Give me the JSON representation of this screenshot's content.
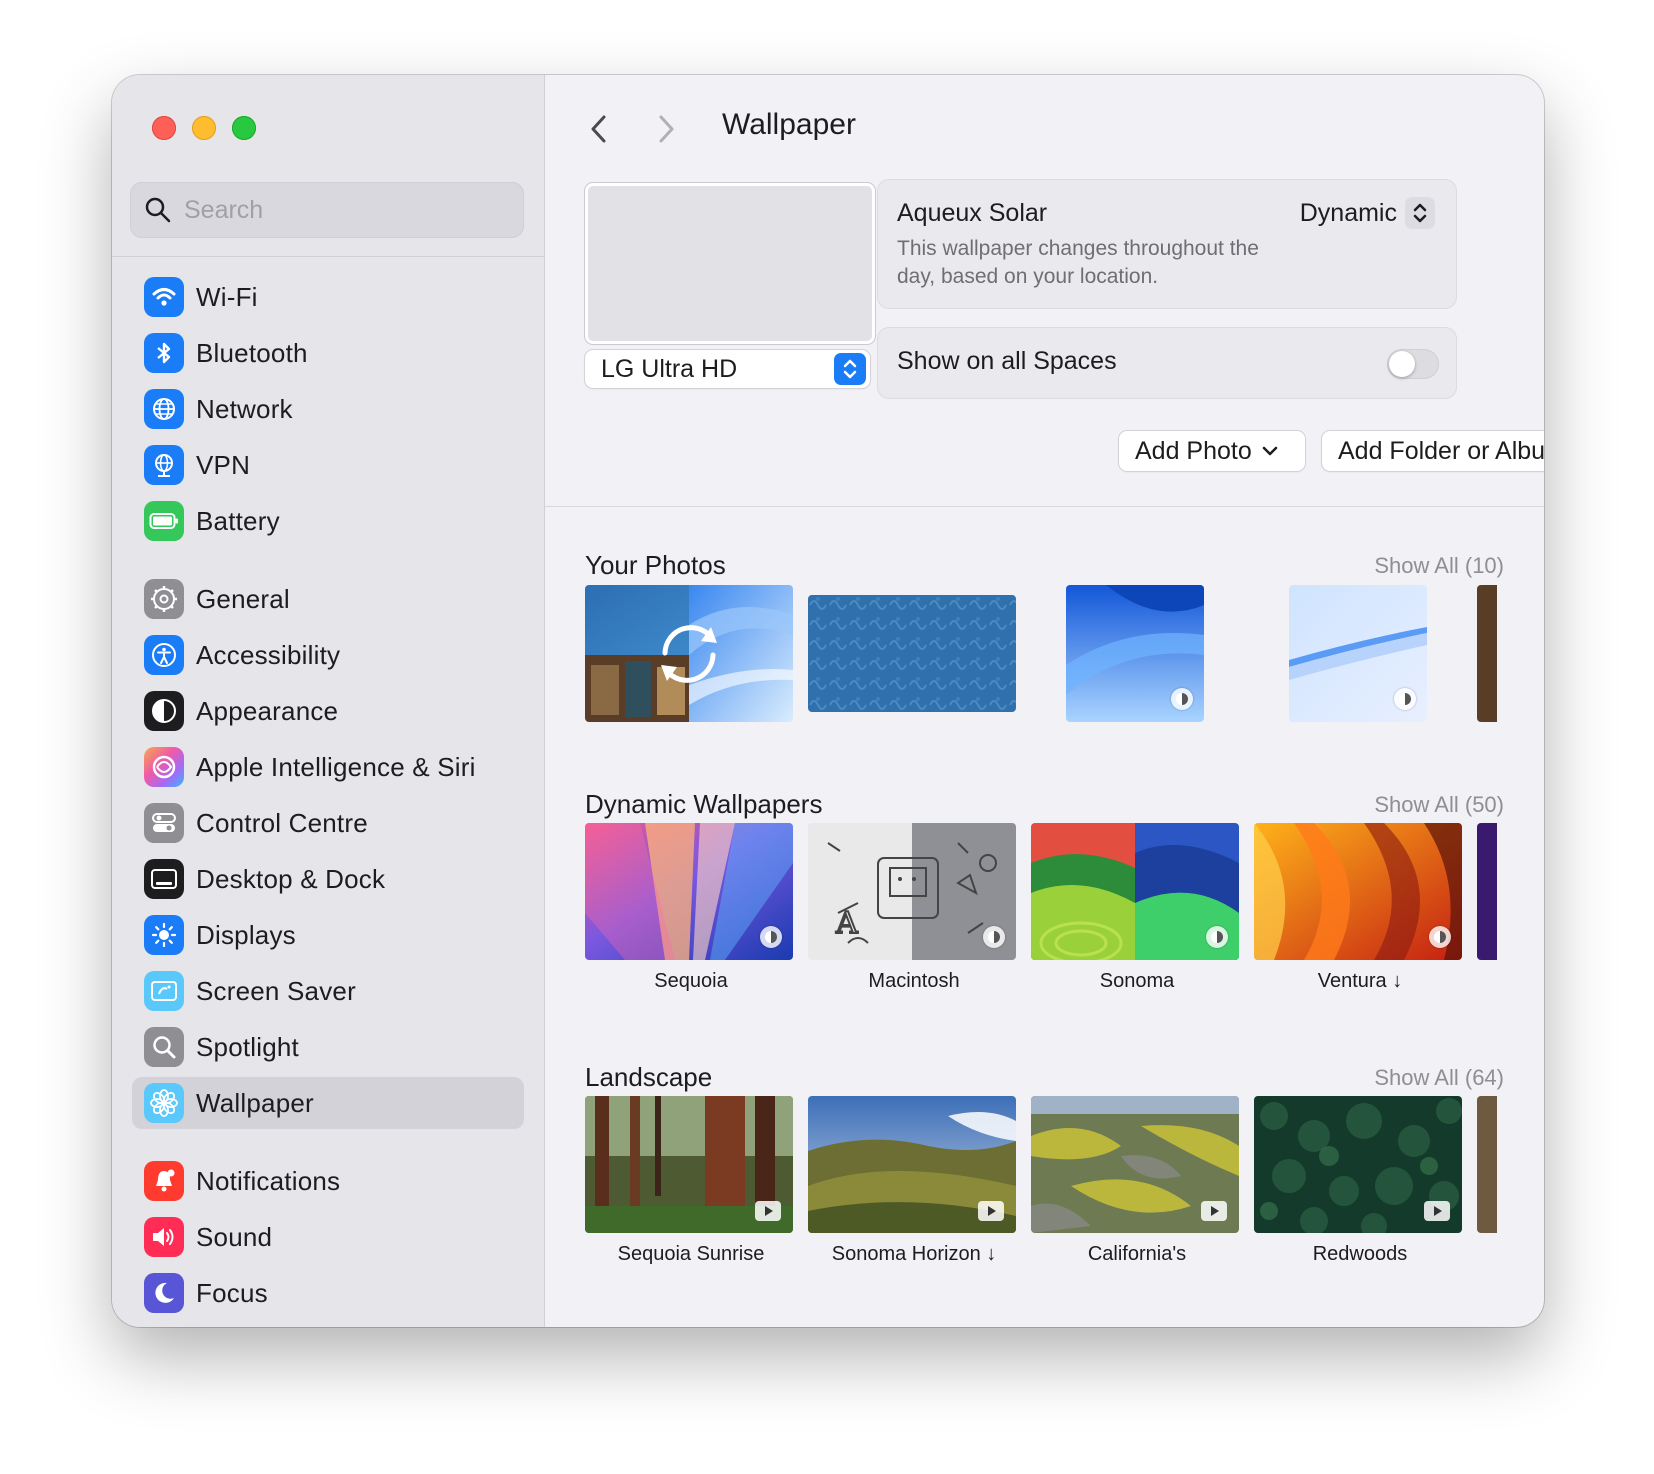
{
  "search": {
    "placeholder": "Search"
  },
  "sidebar": {
    "groups": [
      [
        {
          "label": "Wi-Fi",
          "icon": "wifi-icon",
          "color": "#1a7cf7"
        },
        {
          "label": "Bluetooth",
          "icon": "bluetooth-icon",
          "color": "#1a7cf7"
        },
        {
          "label": "Network",
          "icon": "globe-icon",
          "color": "#1a7cf7"
        },
        {
          "label": "VPN",
          "icon": "vpn-globe-icon",
          "color": "#1a7cf7"
        },
        {
          "label": "Battery",
          "icon": "battery-icon",
          "color": "#34c759"
        }
      ],
      [
        {
          "label": "General",
          "icon": "gear-icon",
          "color": "#8e8e93"
        },
        {
          "label": "Accessibility",
          "icon": "accessibility-icon",
          "color": "#1a7cf7"
        },
        {
          "label": "Appearance",
          "icon": "appearance-icon",
          "color": "#1d1d1f"
        },
        {
          "label": "Apple Intelligence & Siri",
          "icon": "siri-icon",
          "color": "#e85fb0"
        },
        {
          "label": "Control Centre",
          "icon": "control-centre-icon",
          "color": "#8e8e93"
        },
        {
          "label": "Desktop & Dock",
          "icon": "desktop-dock-icon",
          "color": "#1d1d1f"
        },
        {
          "label": "Displays",
          "icon": "sun-icon",
          "color": "#1a7cf7"
        },
        {
          "label": "Screen Saver",
          "icon": "screen-saver-icon",
          "color": "#5ac8fa"
        },
        {
          "label": "Spotlight",
          "icon": "magnifier-icon",
          "color": "#8e8e93"
        },
        {
          "label": "Wallpaper",
          "icon": "flower-icon",
          "color": "#5ac8fa",
          "selected": true
        }
      ],
      [
        {
          "label": "Notifications",
          "icon": "bell-icon",
          "color": "#ff3b30"
        },
        {
          "label": "Sound",
          "icon": "speaker-icon",
          "color": "#ff2d55"
        },
        {
          "label": "Focus",
          "icon": "moon-icon",
          "color": "#5856d6"
        }
      ]
    ]
  },
  "header": {
    "title": "Wallpaper"
  },
  "current": {
    "display": "LG Ultra HD",
    "name": "Aqueux Solar",
    "description": "This wallpaper changes throughout the day, based on your location.",
    "mode": "Dynamic",
    "spaces_label": "Show on all Spaces",
    "spaces_on": false
  },
  "buttons": {
    "add_photo": "Add Photo",
    "add_folder": "Add Folder or Album"
  },
  "sections": [
    {
      "title": "Your Photos",
      "show_all": "Show All (10)",
      "items": [
        {
          "label": "",
          "style": "shuffle"
        },
        {
          "label": "",
          "style": "pattern"
        },
        {
          "label": "",
          "style": "blue-wave",
          "badge": "dynamic"
        },
        {
          "label": "",
          "style": "pale-wave",
          "badge": "dynamic"
        }
      ]
    },
    {
      "title": "Dynamic Wallpapers",
      "show_all": "Show All (50)",
      "items": [
        {
          "label": "Sequoia",
          "style": "sequoia",
          "badge": "dynamic"
        },
        {
          "label": "Macintosh",
          "style": "macintosh",
          "badge": "dynamic"
        },
        {
          "label": "Sonoma",
          "style": "sonoma",
          "badge": "dynamic"
        },
        {
          "label": "Ventura ↓",
          "style": "ventura",
          "badge": "dynamic"
        }
      ]
    },
    {
      "title": "Landscape",
      "show_all": "Show All (64)",
      "items": [
        {
          "label": "Sequoia Sunrise",
          "style": "forest",
          "badge": "video"
        },
        {
          "label": "Sonoma Horizon ↓",
          "style": "hills",
          "badge": "video"
        },
        {
          "label": "California's",
          "style": "aerial",
          "badge": "video"
        },
        {
          "label": "Redwoods",
          "style": "trees",
          "badge": "video"
        }
      ]
    }
  ]
}
